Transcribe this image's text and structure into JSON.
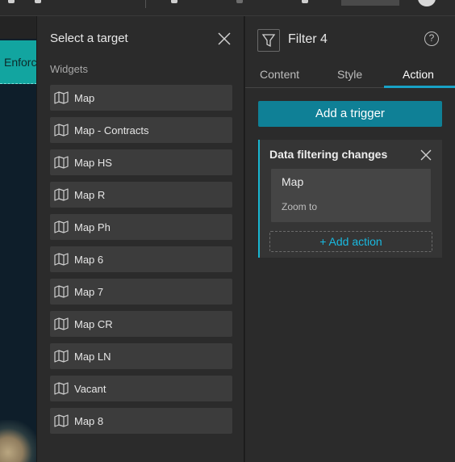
{
  "map_bar": {
    "label": "Enforc"
  },
  "target_panel": {
    "title": "Select a target",
    "section_label": "Widgets",
    "items": [
      {
        "label": "Map",
        "icon": "map-icon"
      },
      {
        "label": "Map - Contracts",
        "icon": "map-icon"
      },
      {
        "label": "Map HS",
        "icon": "map-icon"
      },
      {
        "label": "Map R",
        "icon": "map-icon"
      },
      {
        "label": "Map Ph",
        "icon": "map-icon"
      },
      {
        "label": "Map 6",
        "icon": "map-icon"
      },
      {
        "label": "Map 7",
        "icon": "map-icon"
      },
      {
        "label": "Map CR",
        "icon": "map-icon"
      },
      {
        "label": "Map LN",
        "icon": "map-icon"
      },
      {
        "label": "Vacant",
        "icon": "map-icon"
      },
      {
        "label": "Map 8",
        "icon": "map-icon"
      }
    ]
  },
  "settings": {
    "title": "Filter 4",
    "help": "?",
    "tabs": [
      {
        "label": "Content",
        "active": false
      },
      {
        "label": "Style",
        "active": false
      },
      {
        "label": "Action",
        "active": true
      }
    ],
    "add_trigger_label": "Add a trigger",
    "trigger": {
      "title": "Data filtering changes",
      "action_target": "Map",
      "action_name": "Zoom to",
      "add_action_label": "+ Add action"
    }
  },
  "colors": {
    "accent": "#18a2c6",
    "button": "#0f8096",
    "enforce_bar": "#12a5a0",
    "panel": "#2b2b2b"
  }
}
